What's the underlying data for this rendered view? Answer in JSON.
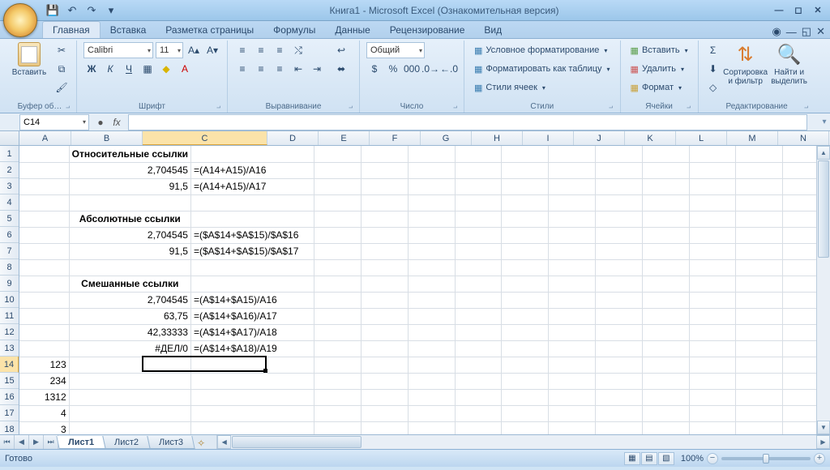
{
  "app": {
    "title": "Книга1 - Microsoft Excel (Ознакомительная версия)"
  },
  "qat": {
    "save": "💾",
    "undo": "↶",
    "redo": "↷"
  },
  "tabs": {
    "items": [
      "Главная",
      "Вставка",
      "Разметка страницы",
      "Формулы",
      "Данные",
      "Рецензирование",
      "Вид"
    ],
    "active": 0
  },
  "ribbon": {
    "clipboard": {
      "label": "Буфер об…",
      "paste": "Вставить"
    },
    "font": {
      "label": "Шрифт",
      "family": "Calibri",
      "size": "11",
      "bold": "Ж",
      "italic": "К",
      "underline": "Ч"
    },
    "align": {
      "label": "Выравнивание"
    },
    "number": {
      "label": "Число",
      "format": "Общий"
    },
    "styles": {
      "label": "Стили",
      "cond": "Условное форматирование",
      "table": "Форматировать как таблицу",
      "cell": "Стили ячеек"
    },
    "cells": {
      "label": "Ячейки",
      "insert": "Вставить",
      "delete": "Удалить",
      "format": "Формат"
    },
    "editing": {
      "label": "Редактирование",
      "sort": "Сортировка\nи фильтр",
      "find": "Найти и\nвыделить"
    }
  },
  "name_box": "C14",
  "columns": [
    "A",
    "B",
    "C",
    "D",
    "E",
    "F",
    "G",
    "H",
    "I",
    "J",
    "K",
    "L",
    "M",
    "N"
  ],
  "col_widths": {
    "A": 64,
    "B": 88,
    "C": 154,
    "other": 63
  },
  "headings": {
    "r1": "Относительные ссылки",
    "r5": "Абсолютные ссылки",
    "r9": "Смешанные ссылки"
  },
  "cells": {
    "B2": "2,704545",
    "C2": "=(A14+A15)/A16",
    "B3": "91,5",
    "C3": "=(A14+A15)/A17",
    "B6": "2,704545",
    "C6": "=($A$14+$A$15)/$A$16",
    "B7": "91,5",
    "C7": "=($A$14+$A$15)/$A$17",
    "B10": "2,704545",
    "C10": "=(A$14+$A15)/A16",
    "B11": "63,75",
    "C11": "=(A$14+$A16)/A17",
    "B12": "42,33333",
    "C12": "=(A$14+$A17)/A18",
    "B13": "#ДЕЛ/0",
    "C13": "=(A$14+$A18)/A19",
    "A14": "123",
    "A15": "234",
    "A16": "1312",
    "A17": "4",
    "A18": "3"
  },
  "selected": {
    "col": 2,
    "row": 14
  },
  "sheets": {
    "items": [
      "Лист1",
      "Лист2",
      "Лист3"
    ],
    "active": 0
  },
  "status": {
    "ready": "Готово",
    "zoom": "100%"
  }
}
